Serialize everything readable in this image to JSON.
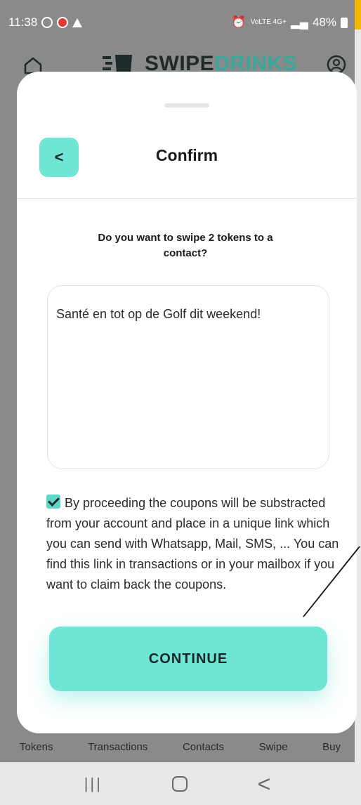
{
  "status_bar": {
    "time": "11:38",
    "network_small": "VoLTE 4G+",
    "battery": "48%"
  },
  "app_header": {
    "logo_text_main": "SWIPE",
    "logo_text_accent": "DRINKS"
  },
  "tabs": [
    "Tokens",
    "Transactions",
    "Contacts",
    "Swipe",
    "Buy"
  ],
  "modal": {
    "back_label": "<",
    "title": "Confirm",
    "question": "Do you want to swipe 2 tokens to a contact?",
    "message_value": "Santé en tot op de Golf dit weekend!",
    "consent_checked": true,
    "consent_text": "By proceeding the coupons will be substracted from your account and place in a unique link which you can send with Whatsapp, Mail, SMS, ... You can find this link in transactions or in your mailbox if you want to claim back the coupons.",
    "continue_label": "CONTINUE"
  },
  "navbar": {
    "recent_label": "|||",
    "back_label": "<"
  },
  "colors": {
    "accent": "#6fe5d6",
    "brand_dark": "#1f2a2a",
    "corner": "#f5b800"
  }
}
